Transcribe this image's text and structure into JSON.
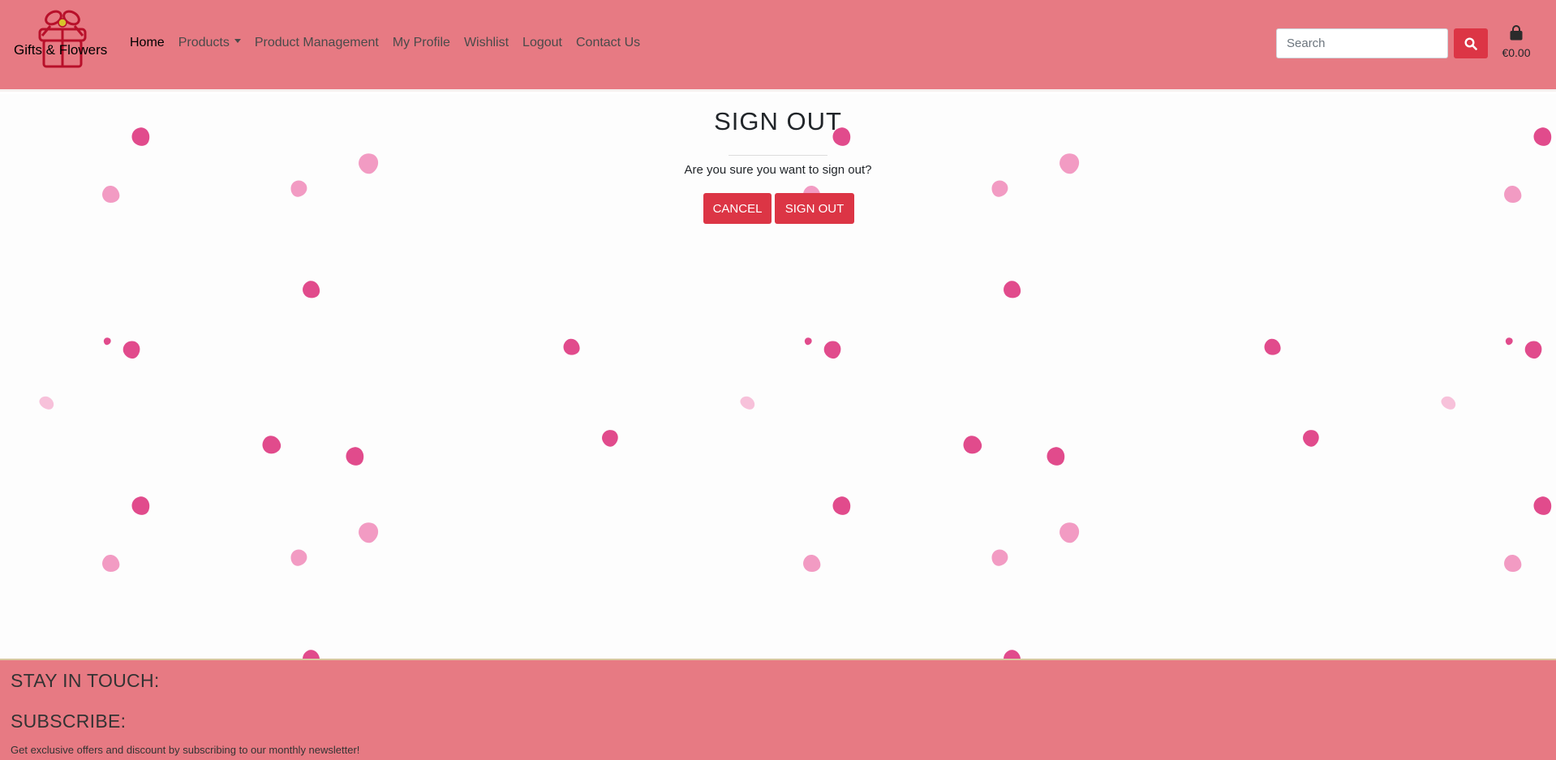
{
  "brand": {
    "name": "Gifts & Flowers",
    "logo_icon": "gift-box-icon"
  },
  "nav": {
    "items": [
      {
        "label": "Home",
        "active": true
      },
      {
        "label": "Products",
        "dropdown": true
      },
      {
        "label": "Product Management"
      },
      {
        "label": "My Profile"
      },
      {
        "label": "Wishlist"
      },
      {
        "label": "Logout"
      },
      {
        "label": "Contact Us"
      }
    ]
  },
  "search": {
    "placeholder": "Search",
    "value": "",
    "button_icon": "search-icon"
  },
  "bag": {
    "icon": "shopping-bag-icon",
    "total": "€0.00"
  },
  "signout": {
    "title": "SIGN OUT",
    "question": "Are you sure you want to sign out?",
    "cancel_label": "CANCEL",
    "confirm_label": "SIGN OUT"
  },
  "footer": {
    "stay_in_touch": "STAY IN TOUCH:",
    "subscribe": "SUBSCRIBE:",
    "newsletter_text": "Get exclusive offers and discount by subscribing to our monthly newsletter!"
  },
  "colors": {
    "navbar_bg": "#e77a83",
    "button_red": "#dc3545",
    "petal_dark": "#e14b8c",
    "petal_light": "#f29bc3"
  }
}
